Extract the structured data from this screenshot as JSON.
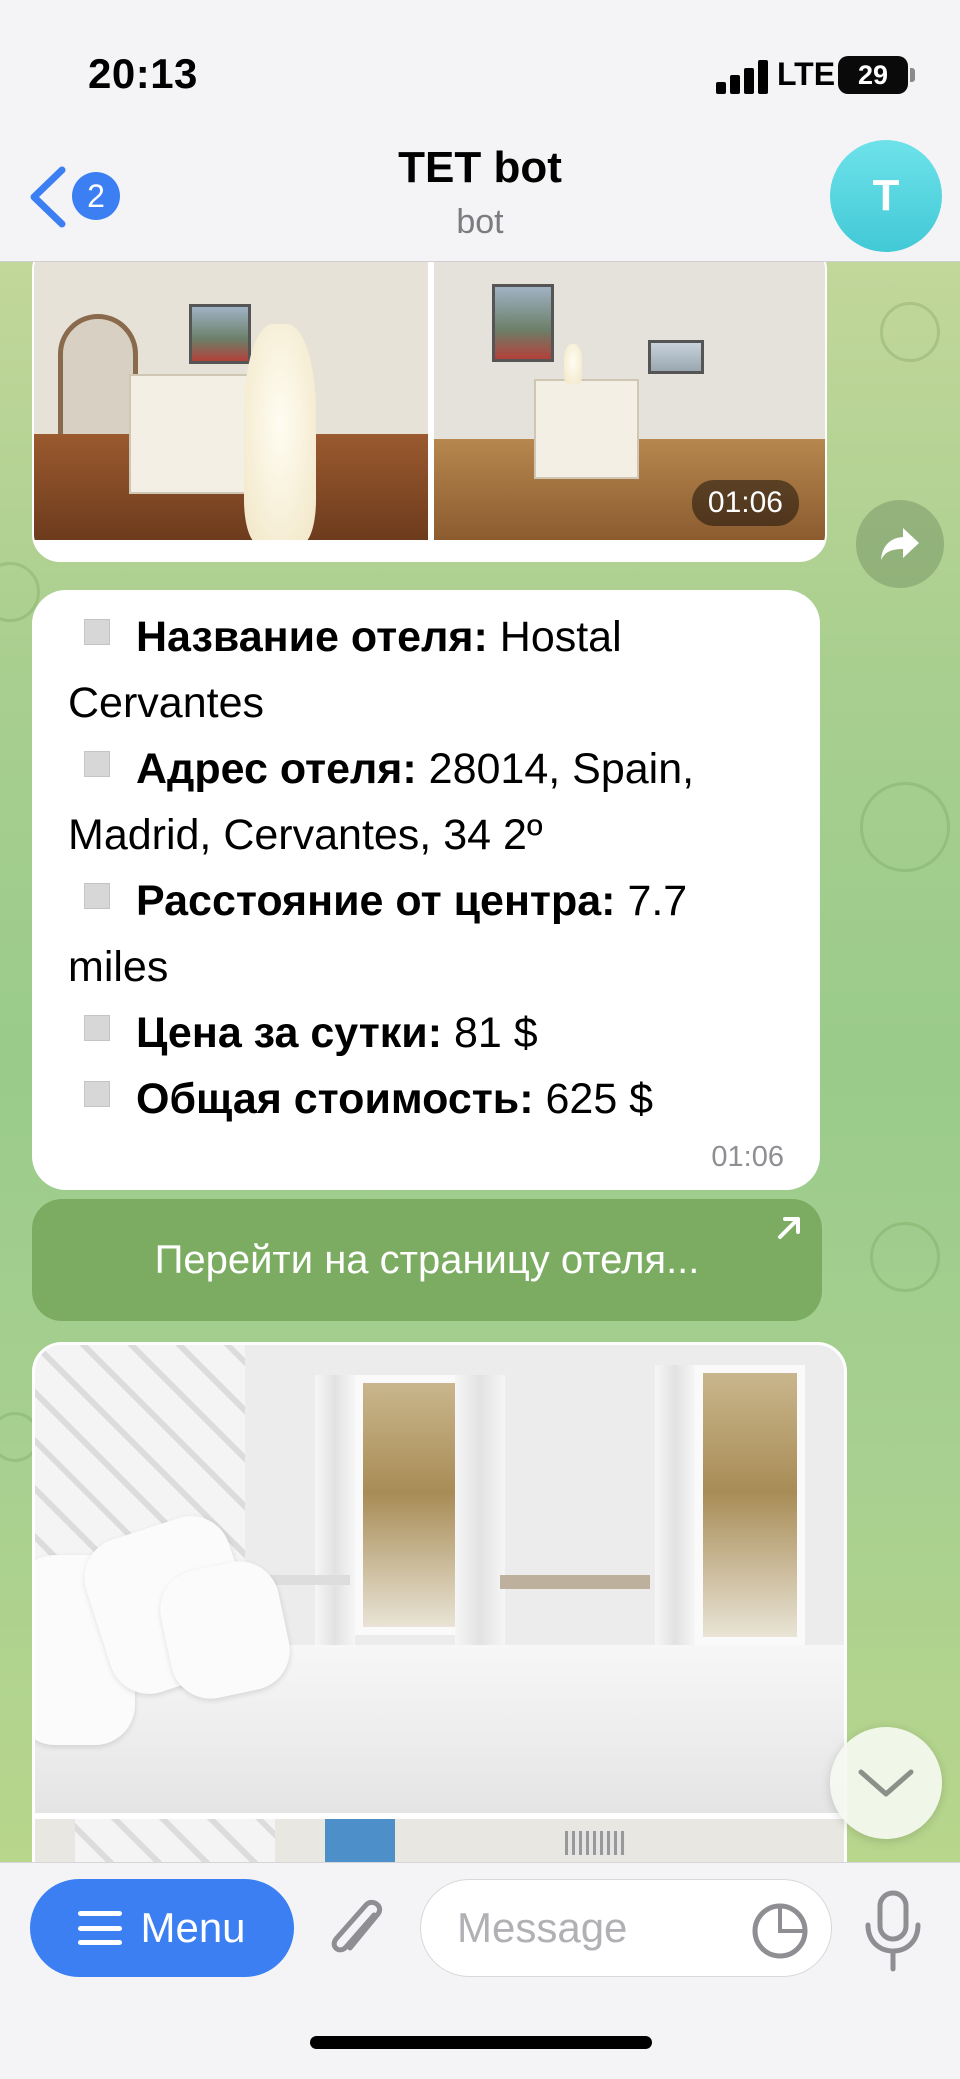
{
  "status_bar": {
    "time": "20:13",
    "network": "LTE",
    "battery": "29"
  },
  "header": {
    "back_badge": "2",
    "title": "TET bot",
    "subtitle": "bot",
    "avatar_letter": "T"
  },
  "messages": {
    "album_top": {
      "time": "01:06"
    },
    "hotel_info": {
      "lines": [
        {
          "label": "Название отеля:",
          "value": " Hostal Cervantes"
        },
        {
          "label": "Адрес отеля:",
          "value": " 28014, Spain, Madrid, Cervantes, 34 2º"
        },
        {
          "label": "Расстояние от центра:",
          "value": " 7.7 miles"
        },
        {
          "label": "Цена за сутки:",
          "value": " 81 $"
        },
        {
          "label": "Общая стоимость:",
          "value": " 625 $"
        }
      ],
      "time": "01:06"
    },
    "url_button": {
      "label": "Перейти на страницу отеля..."
    }
  },
  "input": {
    "menu_label": "Menu",
    "placeholder": "Message"
  },
  "icons": [
    "back-chevron-icon",
    "share-icon",
    "scroll-down-icon",
    "hamburger-icon",
    "attach-icon",
    "sticker-icon",
    "microphone-icon",
    "external-link-icon"
  ],
  "colors": {
    "accent": "#3b7ff2",
    "avatar": "#4fd2de",
    "button_green": "#7fb060"
  }
}
